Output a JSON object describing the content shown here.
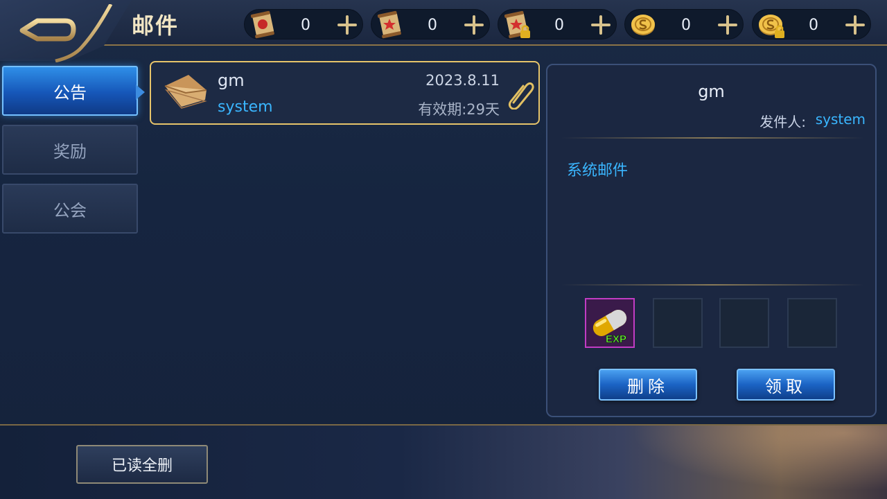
{
  "header": {
    "title": "邮件",
    "currencies": [
      {
        "icon": "red-scroll-icon",
        "amount": "0"
      },
      {
        "icon": "star-scroll-icon",
        "amount": "0"
      },
      {
        "icon": "locked-scroll-icon",
        "amount": "0"
      },
      {
        "icon": "gold-coin-icon",
        "amount": "0"
      },
      {
        "icon": "locked-gold-coin-icon",
        "amount": "0"
      }
    ]
  },
  "tabs": [
    {
      "label": "公告",
      "active": true
    },
    {
      "label": "奖励",
      "active": false
    },
    {
      "label": "公会",
      "active": false
    }
  ],
  "mail_list": [
    {
      "title": "gm",
      "sender": "system",
      "date": "2023.8.11",
      "expiry": "有效期:29天",
      "has_attachment": true
    }
  ],
  "detail": {
    "title": "gm",
    "sender_label": "发件人:",
    "sender": "system",
    "body": "系统邮件",
    "attachments": [
      {
        "icon": "exp-capsule-icon",
        "filled": true
      },
      {
        "filled": false
      },
      {
        "filled": false
      },
      {
        "filled": false
      }
    ],
    "delete_label": "删除",
    "claim_label": "领取"
  },
  "footer": {
    "delete_read_label": "已读全删"
  },
  "colors": {
    "accent_blue": "#3ab6ff",
    "gold_border": "#e7c46a",
    "attachment_border": "#c23cc4"
  }
}
